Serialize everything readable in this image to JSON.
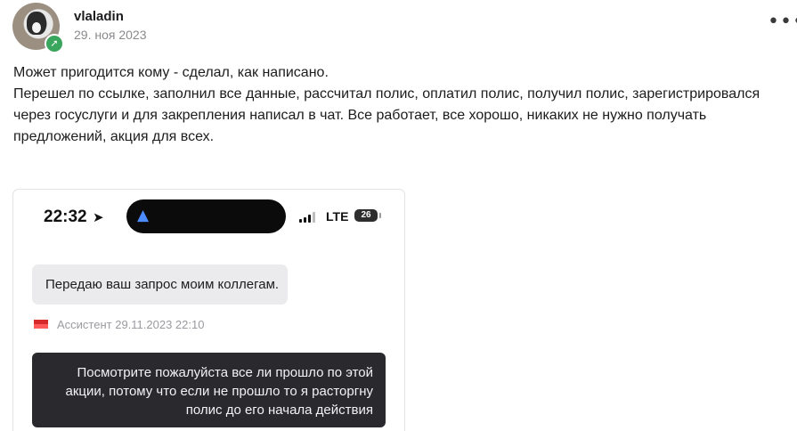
{
  "post": {
    "author": "vlaladin",
    "date": "29. ноя 2023",
    "more_icon": "more-horizontal-icon",
    "badge_icon": "upvote-arrow-icon",
    "lines": [
      "Может пригодится кому - сделал, как написано.",
      "Перешел по ссылке, заполнил все данные, рассчитал полис, оплатил полис, получил полис, зарегистрировался",
      "через госуслуги и для закрепления написал в чат. Все работает, все хорошо, никаких не нужно получать",
      "предложений, акция для всех."
    ]
  },
  "screenshot": {
    "status_bar": {
      "time": "22:32",
      "network": "LTE",
      "battery": "26"
    },
    "messages": [
      {
        "text": "Передаю ваш запрос моим коллегам.",
        "sender_meta": "Ассистент 29.11.2023 22:10"
      },
      {
        "text": "Посмотрите пожалуйста все ли прошло по этой акции, потому что если не прошло то я расторгну полис до его начала действия"
      }
    ]
  },
  "colors": {
    "text": "#1c1c1e",
    "muted": "#8a8a8e",
    "badge_green": "#3aa55c",
    "incoming_bubble": "#ebebee",
    "outgoing_bubble": "#2a2a2e"
  }
}
